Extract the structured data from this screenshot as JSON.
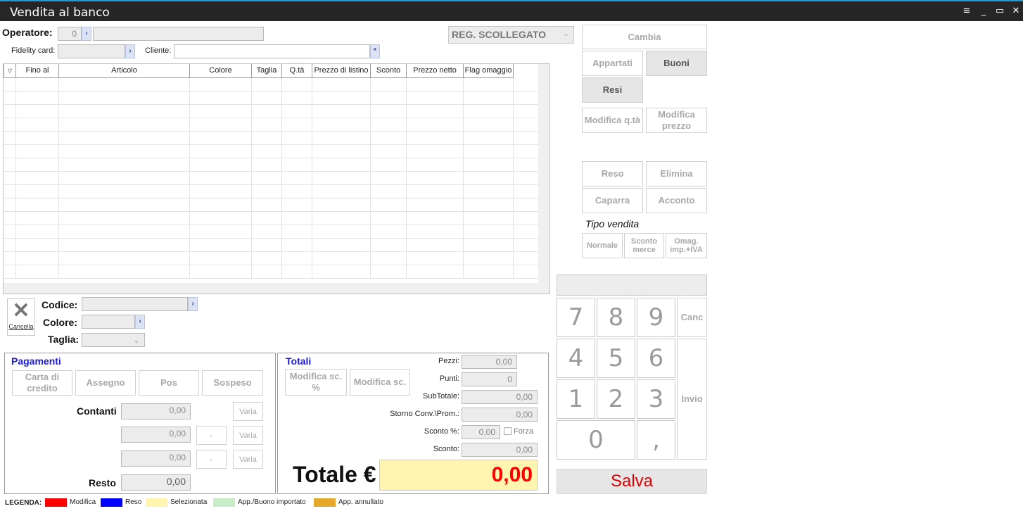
{
  "window": {
    "title": "Vendita al banco",
    "controls": [
      "≡",
      "_",
      "▭",
      "✕"
    ]
  },
  "header": {
    "operatore_label": "Operatore:",
    "operatore_value": "0",
    "fidelity_label": "Fidelity card:",
    "cliente_label": "Cliente:",
    "status_select": "REG. SCOLLEGATO"
  },
  "grid": {
    "columns": [
      "",
      "Fino al",
      "Articolo",
      "Colore",
      "Taglia",
      "Q.tà",
      "Prezzo di listino",
      "Sconto",
      "Prezzo netto",
      "Flag omaggio"
    ]
  },
  "entry": {
    "cancella_label": "Cancella",
    "codice_label": "Codice:",
    "colore_label": "Colore:",
    "taglia_label": "Taglia:"
  },
  "pagamenti": {
    "title": "Pagamenti",
    "buttons": [
      "Carta di credito",
      "Assegno",
      "Pos",
      "Sospeso"
    ],
    "contanti_label": "Contanti",
    "contanti_value": "0,00",
    "row2_value": "0,00",
    "row3_value": "0,00",
    "dash": "-",
    "varia_label": "Varia",
    "resto_label": "Resto",
    "resto_value": "0,00"
  },
  "totali": {
    "title": "Totali",
    "modifica_sc_pct": "Modifica sc. %",
    "modifica_sc": "Modifica sc.",
    "pezzi_label": "Pezzi:",
    "pezzi_value": "0,00",
    "punti_label": "Punti:",
    "punti_value": "0",
    "subtotale_label": "SubTotale:",
    "subtotale_value": "0,00",
    "storno_label": "Storno Conv.\\Prom.:",
    "storno_value": "0,00",
    "sconto_pct_label": "Sconto %:",
    "sconto_pct_value": "0,00",
    "forza_label": "Forza",
    "sconto_label": "Sconto:",
    "sconto_value": "0,00",
    "totale_label": "Totale €",
    "totale_value": "0,00"
  },
  "actions": {
    "cambia": "Cambia",
    "appartati": "Appartati",
    "buoni": "Buoni",
    "resi": "Resi",
    "modifica_qta": "Modifica q.tà",
    "modifica_prezzo": "Modifica prezzo",
    "reso": "Reso",
    "elimina": "Elimina",
    "caparra": "Caparra",
    "acconto": "Acconto",
    "tipo_vendita_label": "Tipo vendita",
    "normale": "Normale",
    "sconto_merce": "Sconto merce",
    "omag_iva": "Omag. imp.+IVA"
  },
  "keypad": {
    "keys": [
      "7",
      "8",
      "9",
      "4",
      "5",
      "6",
      "1",
      "2",
      "3",
      "0",
      ","
    ],
    "canc": "Canc",
    "invio": "Invio",
    "salva": "Salva"
  },
  "legend": {
    "title": "LEGENDA:",
    "items": [
      {
        "label": "Modifica",
        "color": "#ff0000"
      },
      {
        "label": "Reso",
        "color": "#0000ff"
      },
      {
        "label": "Selezionata",
        "color": "#fff5b0"
      },
      {
        "label": "App./Buono importato",
        "color": "#c8ecc8"
      },
      {
        "label": "App. annullato",
        "color": "#e6a82a"
      }
    ]
  },
  "colors": {
    "accent": "#1e9bd7",
    "totale_bg": "#fff5b0",
    "totale_text": "#ff0000",
    "salva_text": "#e00000",
    "section_title": "#1a1ae0"
  }
}
